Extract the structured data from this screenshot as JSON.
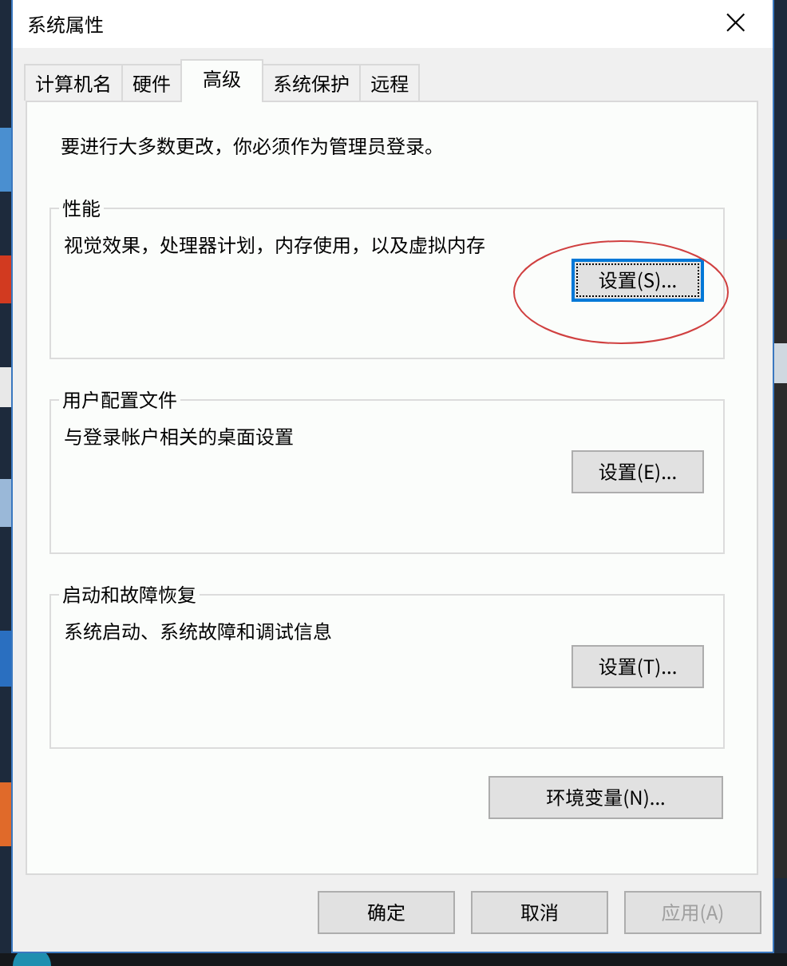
{
  "window": {
    "title": "系统属性",
    "close": "×"
  },
  "tabs": [
    {
      "label": "计算机名",
      "selected": false
    },
    {
      "label": "硬件",
      "selected": false
    },
    {
      "label": "高级",
      "selected": true
    },
    {
      "label": "系统保护",
      "selected": false
    },
    {
      "label": "远程",
      "selected": false
    }
  ],
  "notice": "要进行大多数更改，你必须作为管理员登录。",
  "groups": [
    {
      "title": "性能",
      "description": "视觉效果，处理器计划，内存使用，以及虚拟内存",
      "button": {
        "label": "设置(S)...",
        "focused": true,
        "circled": true
      }
    },
    {
      "title": "用户配置文件",
      "description": "与登录帐户相关的桌面设置",
      "button": {
        "label": "设置(E)...",
        "focused": false,
        "circled": false
      }
    },
    {
      "title": "启动和故障恢复",
      "description": "系统启动、系统故障和调试信息",
      "button": {
        "label": "设置(T)...",
        "focused": false,
        "circled": false
      }
    }
  ],
  "env_button": "环境变量(N)...",
  "buttons": [
    {
      "label": "确定",
      "disabled": false
    },
    {
      "label": "取消",
      "disabled": false
    },
    {
      "label": "应用(A)",
      "disabled": true
    }
  ]
}
